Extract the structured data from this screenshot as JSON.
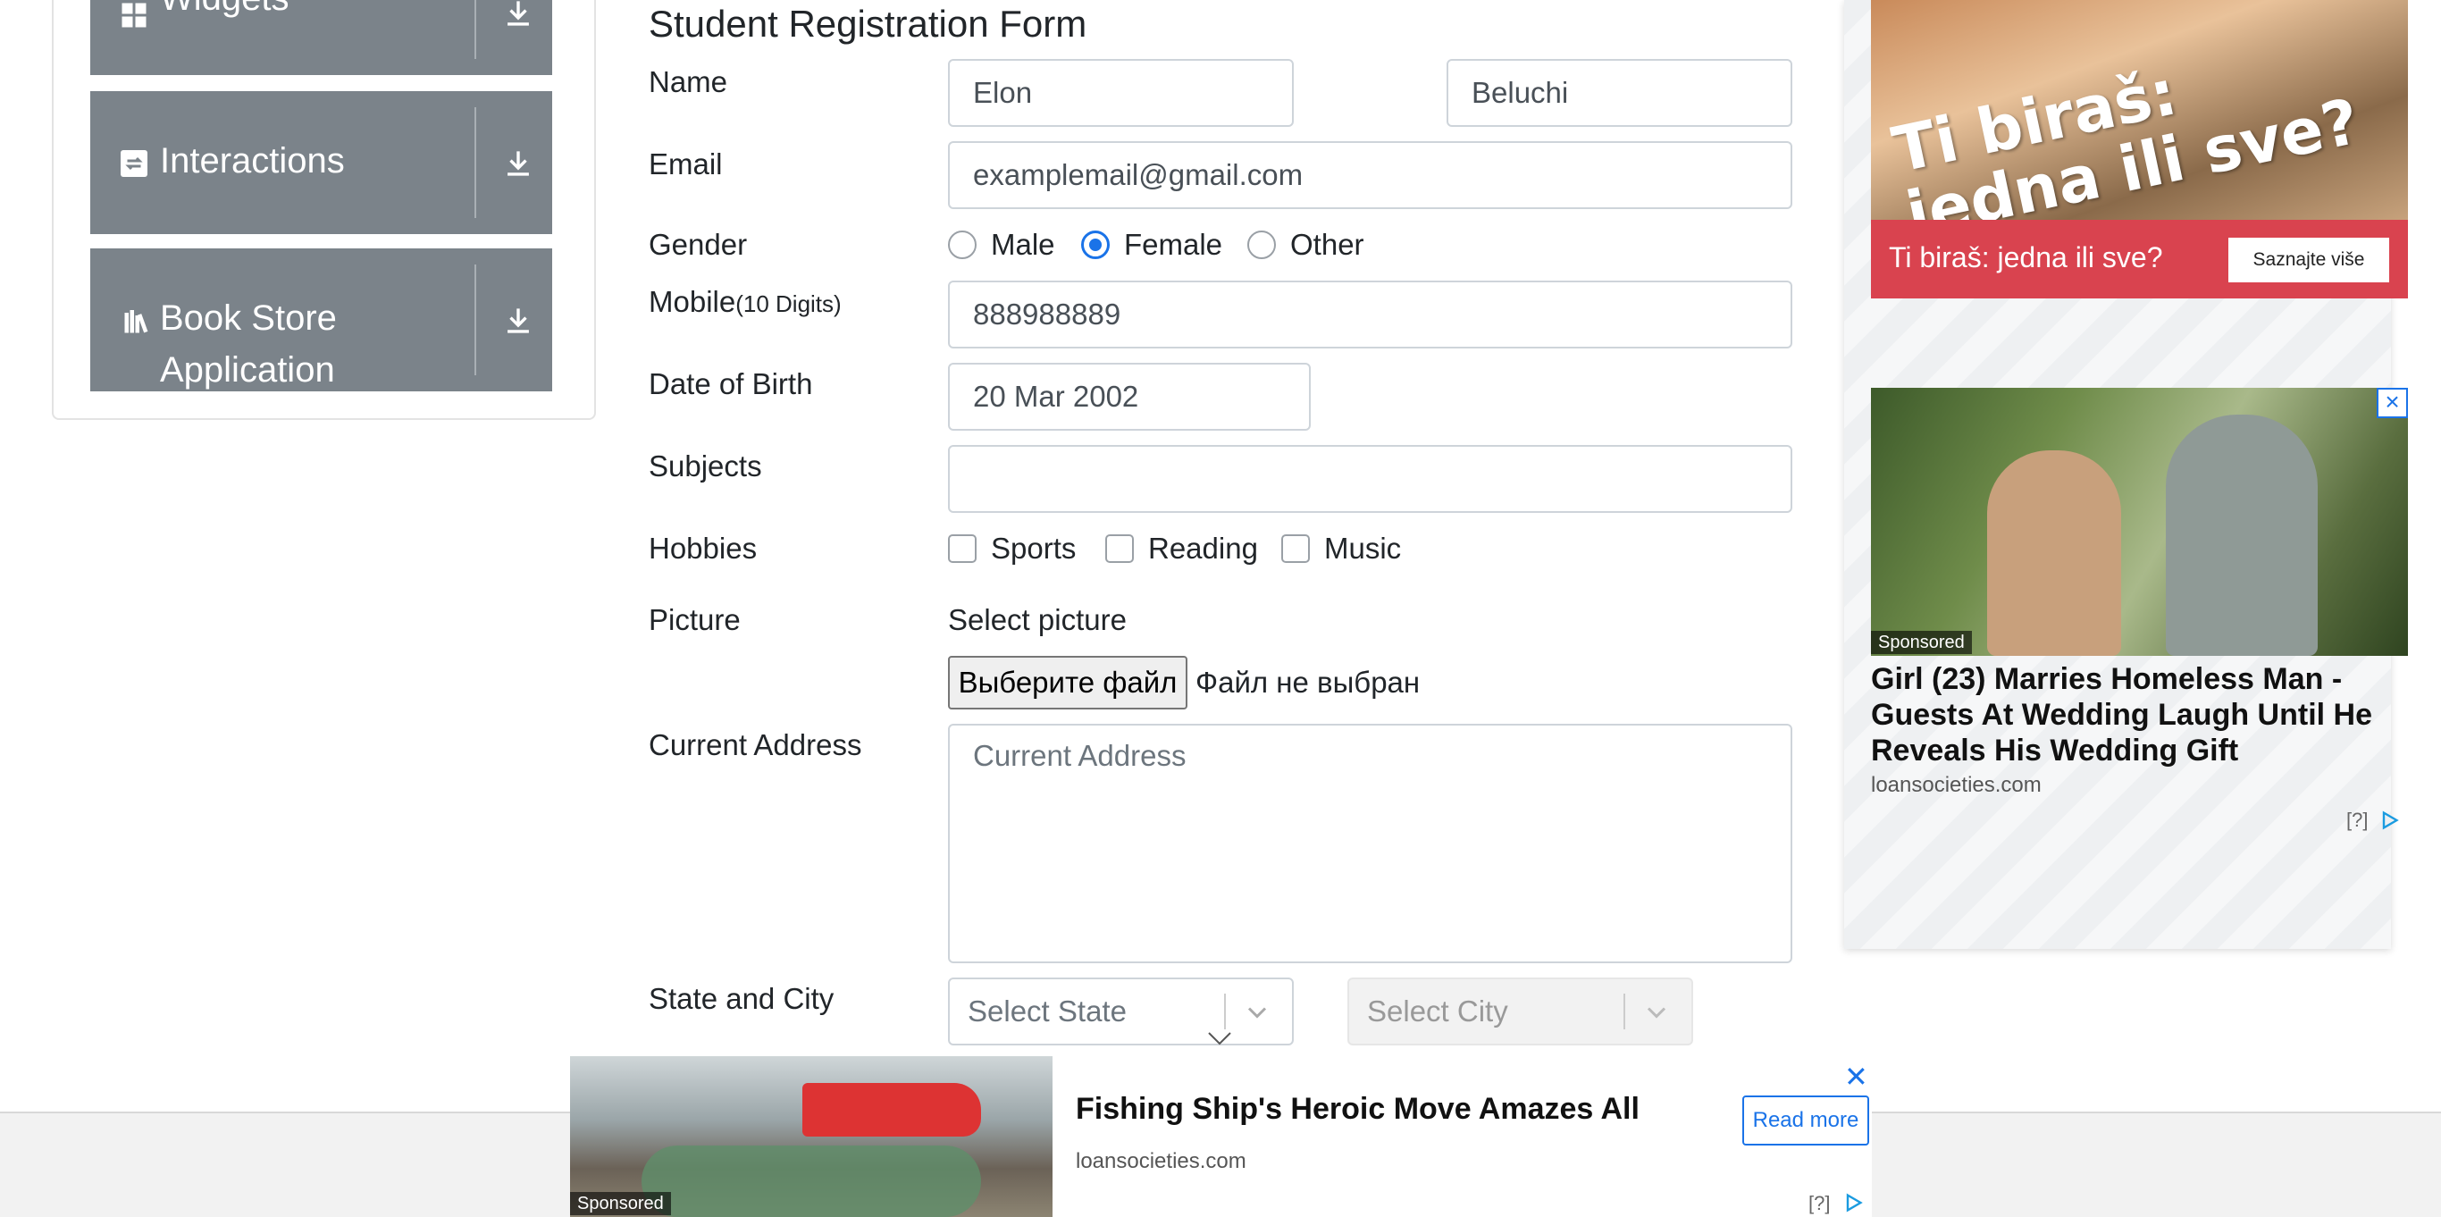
{
  "sidebar": {
    "items": [
      {
        "label": "Widgets",
        "icon": "widgets-icon"
      },
      {
        "label": "Interactions",
        "icon": "interactions-icon"
      },
      {
        "label": "Book Store",
        "label2": "Application",
        "icon": "book-store-icon"
      }
    ]
  },
  "form": {
    "title": "Student Registration Form",
    "name_label": "Name",
    "first_name": "Elon",
    "last_name": "Beluchi",
    "email_label": "Email",
    "email": "examplemail@gmail.com",
    "gender_label": "Gender",
    "gender_options": [
      "Male",
      "Female",
      "Other"
    ],
    "gender_selected": "Female",
    "mobile_label": "Mobile",
    "mobile_hint": "(10 Digits)",
    "mobile": "888988889",
    "dob_label": "Date of Birth",
    "dob": "20 Mar 2002",
    "subjects_label": "Subjects",
    "subjects": "",
    "hobbies_label": "Hobbies",
    "hobbies": [
      "Sports",
      "Reading",
      "Music"
    ],
    "picture_label": "Picture",
    "select_picture": "Select picture",
    "file_button": "Выберите файл",
    "file_status": "Файл не выбран",
    "address_label": "Current Address",
    "address_placeholder": "Current Address",
    "state_city_label": "State and City",
    "state_placeholder": "Select State",
    "city_placeholder": "Select City"
  },
  "ads": {
    "ad1": {
      "slogan_line1": "Ti biraš:",
      "slogan_line2": "jedna ili sve?",
      "bar_text": "Ti biraš: jedna ili sve?",
      "button": "Saznajte više",
      "color": "#d9434f"
    },
    "ad2": {
      "sponsored": "Sponsored",
      "headline": "Girl (23) Marries Homeless Man - Guests At Wedding Laugh Until He Reveals His Wedding Gift",
      "domain": "loansocieties.com",
      "help": "[?]"
    },
    "ad3": {
      "sponsored": "Sponsored",
      "headline": "Fishing Ship's Heroic Move Amazes All",
      "domain": "loansocieties.com",
      "button": "Read more",
      "help": "[?]"
    }
  },
  "colors": {
    "sidebar_bg": "#7b838a",
    "accent": "#1a73e8"
  }
}
